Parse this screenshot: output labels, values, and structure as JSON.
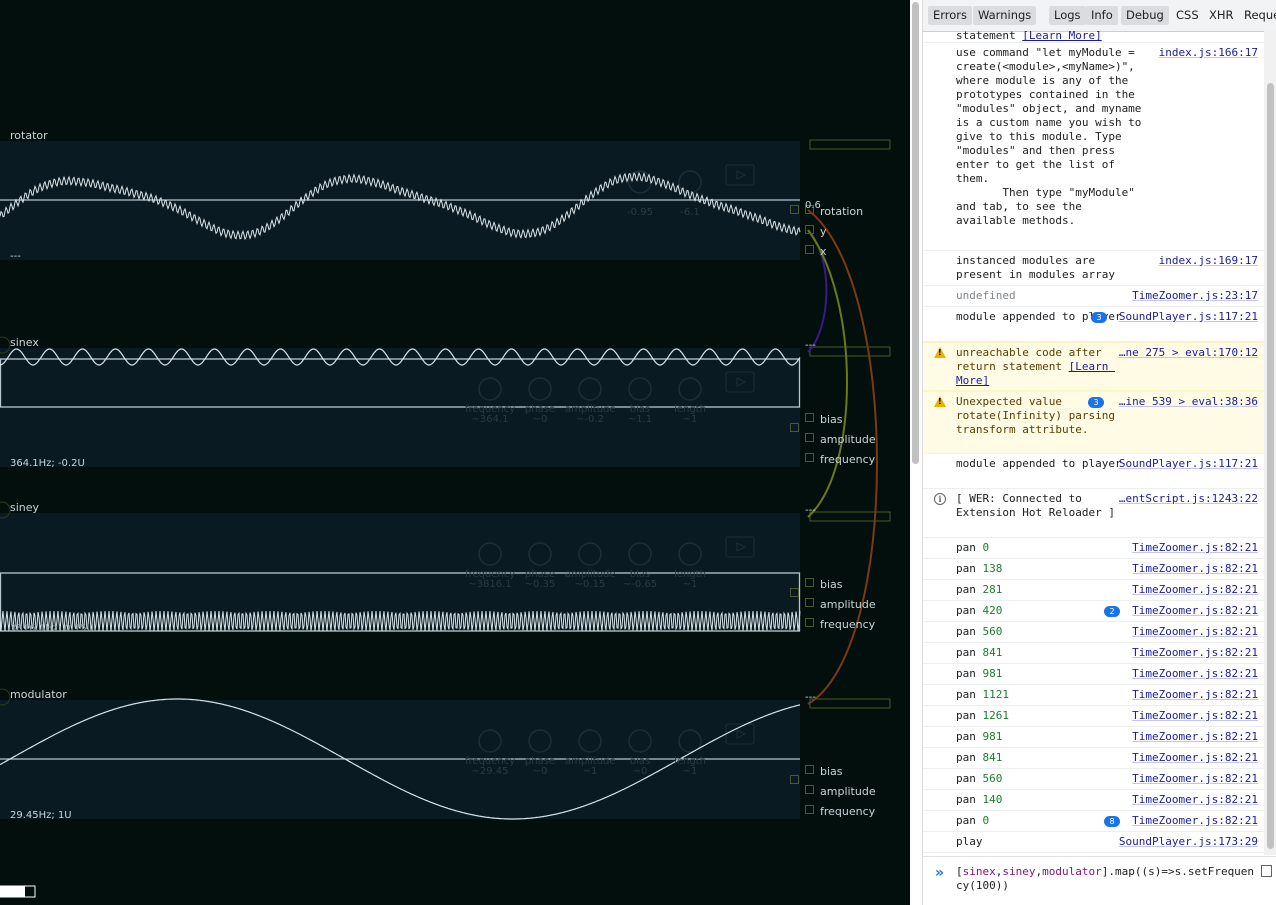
{
  "modules": [
    {
      "id": "rotator",
      "title": "rotator",
      "status": "---",
      "knobs": [
        {
          "label": "",
          "value": "-0.95"
        },
        {
          "label": "",
          "value": "-6.1"
        }
      ],
      "ports": [
        {
          "label": "rotation",
          "value": "0.6"
        },
        {
          "label": "y"
        },
        {
          "label": "x"
        }
      ],
      "out_label": ""
    },
    {
      "id": "sinex",
      "title": "sinex",
      "status": "364.1Hz; -0.2U",
      "knobs": [
        {
          "label": "frequency",
          "value": "~364.1"
        },
        {
          "label": "phase",
          "value": "~0"
        },
        {
          "label": "amplitude",
          "value": "~-0.2"
        },
        {
          "label": "bias",
          "value": "~1.1"
        },
        {
          "label": "length",
          "value": "~1"
        }
      ],
      "ports": [
        {
          "label": "bias"
        },
        {
          "label": "amplitude"
        },
        {
          "label": "frequency"
        }
      ],
      "out_label": "---"
    },
    {
      "id": "siney",
      "title": "siney",
      "status": "3816.1Hz; 0.15U",
      "knobs": [
        {
          "label": "frequency",
          "value": "~3816.1"
        },
        {
          "label": "phase",
          "value": "~0.35"
        },
        {
          "label": "amplitude",
          "value": "~0.15"
        },
        {
          "label": "bias",
          "value": "~-0.65"
        },
        {
          "label": "length",
          "value": "~1"
        }
      ],
      "ports": [
        {
          "label": "bias"
        },
        {
          "label": "amplitude"
        },
        {
          "label": "frequency"
        }
      ],
      "out_label": "---"
    },
    {
      "id": "modulator",
      "title": "modulator",
      "status": "29.45Hz; 1U",
      "knobs": [
        {
          "label": "frequency",
          "value": "~29.45"
        },
        {
          "label": "phase",
          "value": "~0"
        },
        {
          "label": "amplitude",
          "value": "~1"
        },
        {
          "label": "bias",
          "value": "~0"
        },
        {
          "label": "length",
          "value": "~1"
        }
      ],
      "ports": [
        {
          "label": "bias"
        },
        {
          "label": "amplitude"
        },
        {
          "label": "frequency"
        }
      ],
      "out_label": "---"
    }
  ],
  "colors": {
    "bg": "#030f0d",
    "panel": "#0a1a22",
    "wave": "#d9e4e8",
    "cable_purple": "#3a1a8a",
    "cable_olive": "#6b7a16",
    "cable_brown": "#7a3a12",
    "box": "#4b5a2c"
  },
  "devtools": {
    "filters": [
      "Errors",
      "Warnings",
      "Logs",
      "Info",
      "Debug"
    ],
    "filters_text": [
      "CSS",
      "XHR",
      "Reque"
    ],
    "rows": [
      {
        "kind": "log",
        "msg": "statement",
        "link": "[Learn More]",
        "src": ""
      },
      {
        "kind": "log",
        "msg": "use command \"let myModule = create(<module>,<myName>)\", where module is any of the prototypes contained in the \"modules\" object, and myname is a custom name you wish to give to this module. Type \"modules\" and then press enter to get the list of them.\n       Then type \"myModule\" and tab, to see the available methods.",
        "src": "index.js:166:17"
      },
      {
        "kind": "log",
        "msg": "instanced modules are present in modules array",
        "src": "index.js:169:17"
      },
      {
        "kind": "undef",
        "msg": "undefined",
        "src": "TimeZoomer.js:23:17"
      },
      {
        "kind": "log",
        "msg": "module appended to player",
        "badge": "3",
        "src": "SoundPlayer.js:117:21"
      },
      {
        "kind": "warn",
        "msg": "unreachable code after return statement",
        "link": "[Learn More]",
        "src": "…ne 275 > eval:170:12"
      },
      {
        "kind": "warn",
        "msg": "Unexpected value rotate(Infinity) parsing transform attribute.",
        "badge": "3",
        "src": "…ine 539 > eval:38:36"
      },
      {
        "kind": "log",
        "msg": "module appended to player",
        "src": "SoundPlayer.js:117:21"
      },
      {
        "kind": "info",
        "msg": "[ WER: Connected to Extension Hot Reloader ]",
        "src": "…entScript.js:1243:22"
      },
      {
        "kind": "pan",
        "msg": "pan",
        "num": "0",
        "src": "TimeZoomer.js:82:21"
      },
      {
        "kind": "pan",
        "msg": "pan",
        "num": "138",
        "src": "TimeZoomer.js:82:21"
      },
      {
        "kind": "pan",
        "msg": "pan",
        "num": "281",
        "src": "TimeZoomer.js:82:21"
      },
      {
        "kind": "pan",
        "msg": "pan",
        "num": "420",
        "badge": "2",
        "src": "TimeZoomer.js:82:21"
      },
      {
        "kind": "pan",
        "msg": "pan",
        "num": "560",
        "src": "TimeZoomer.js:82:21"
      },
      {
        "kind": "pan",
        "msg": "pan",
        "num": "841",
        "src": "TimeZoomer.js:82:21"
      },
      {
        "kind": "pan",
        "msg": "pan",
        "num": "981",
        "src": "TimeZoomer.js:82:21"
      },
      {
        "kind": "pan",
        "msg": "pan",
        "num": "1121",
        "src": "TimeZoomer.js:82:21"
      },
      {
        "kind": "pan",
        "msg": "pan",
        "num": "1261",
        "src": "TimeZoomer.js:82:21"
      },
      {
        "kind": "pan",
        "msg": "pan",
        "num": "981",
        "src": "TimeZoomer.js:82:21"
      },
      {
        "kind": "pan",
        "msg": "pan",
        "num": "841",
        "src": "TimeZoomer.js:82:21"
      },
      {
        "kind": "pan",
        "msg": "pan",
        "num": "560",
        "src": "TimeZoomer.js:82:21"
      },
      {
        "kind": "pan",
        "msg": "pan",
        "num": "140",
        "src": "TimeZoomer.js:82:21"
      },
      {
        "kind": "pan",
        "msg": "pan",
        "num": "0",
        "badge": "8",
        "src": "TimeZoomer.js:82:21"
      },
      {
        "kind": "log",
        "msg": "play",
        "src": "SoundPlayer.js:173:29"
      }
    ],
    "command": {
      "open": "[",
      "vars": [
        "sinex",
        "siney",
        "modulator"
      ],
      "rest": "].map((s)=>s.setFrequency(100))"
    }
  }
}
